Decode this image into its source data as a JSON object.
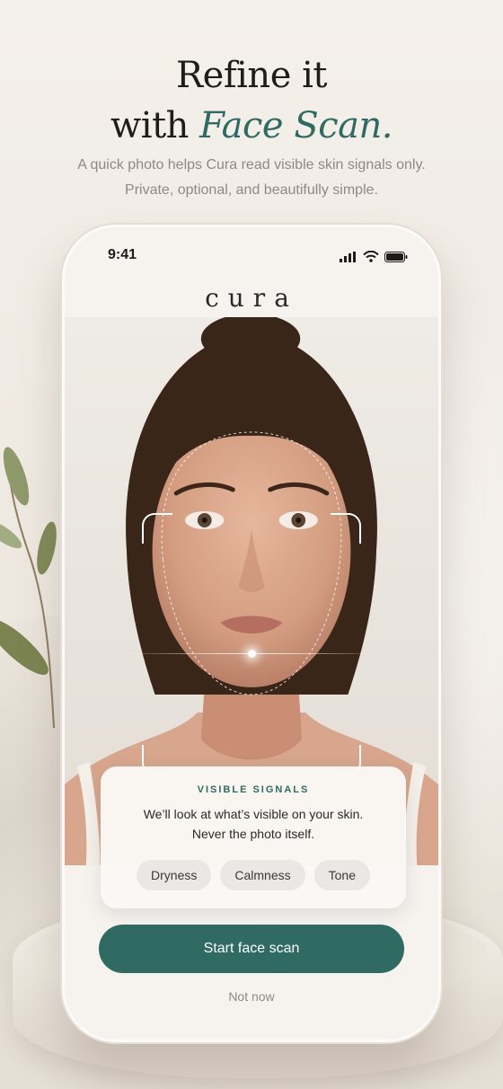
{
  "headline": {
    "line1": "Refine it",
    "line2_prefix": "with",
    "line2_accent": "Face Scan."
  },
  "subtitle": {
    "line1": "A quick photo helps Cura read visible skin signals only.",
    "line2": "Private, optional, and beautifully simple."
  },
  "phone": {
    "status_time": "9:41",
    "status_icons": [
      "signal-icon",
      "wifi-icon",
      "battery-icon"
    ],
    "brand": "cura",
    "card": {
      "label": "VISIBLE SIGNALS",
      "text_line1": "We’ll look at what’s visible on your skin.",
      "text_line2": "Never the photo itself.",
      "chips": [
        "Dryness",
        "Calmness",
        "Tone"
      ]
    },
    "primary_button": "Start face scan",
    "secondary_link": "Not now"
  },
  "colors": {
    "accent": "#2f6b63",
    "background": "#f1ece6",
    "headline": "#1f1d1a"
  }
}
